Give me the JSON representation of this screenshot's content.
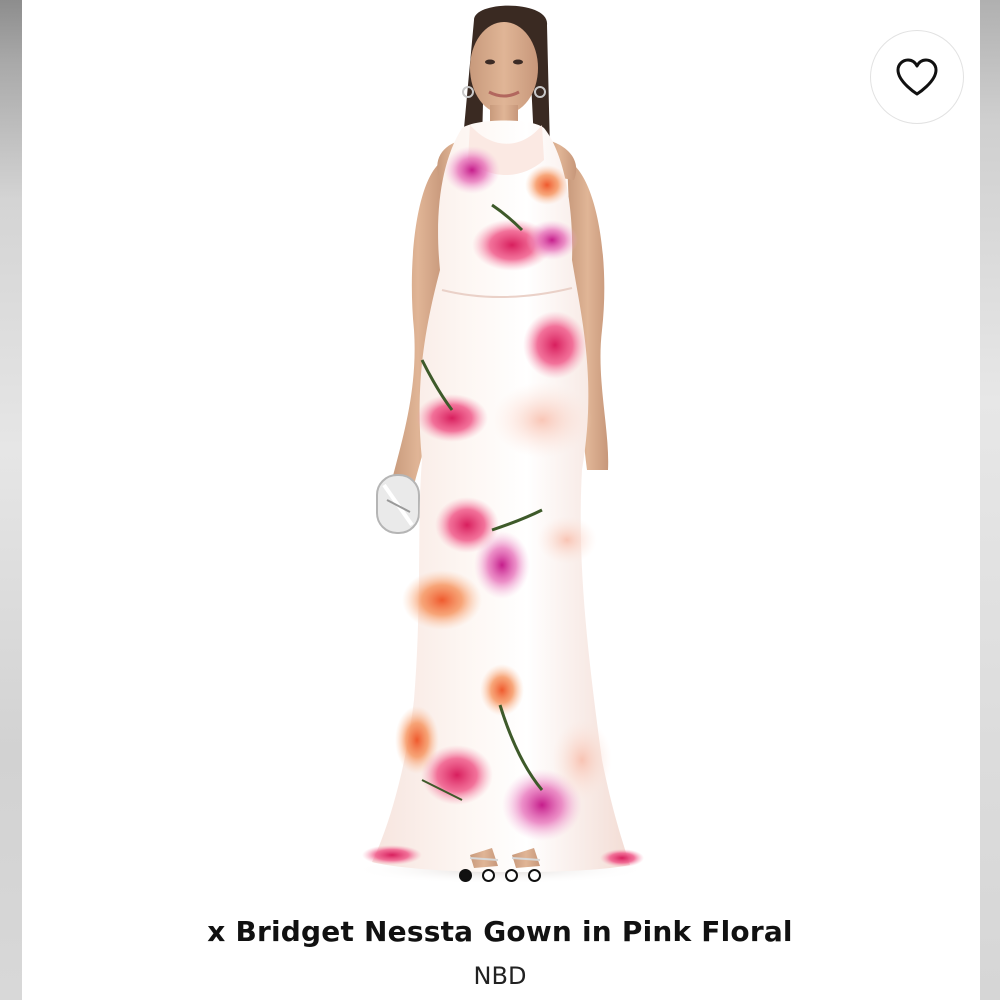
{
  "product": {
    "title": "x Bridget Nessta Gown in Pink Floral",
    "brand": "NBD",
    "image_alt": "Model wearing pink floral satin halter gown"
  },
  "wishlist": {
    "icon": "heart-outline-icon"
  },
  "carousel": {
    "total": 4,
    "active_index": 0
  },
  "colors": {
    "text": "#111111",
    "dot_active": "#111111",
    "accent_pink": "#e8367a",
    "accent_orange": "#f0823c"
  }
}
